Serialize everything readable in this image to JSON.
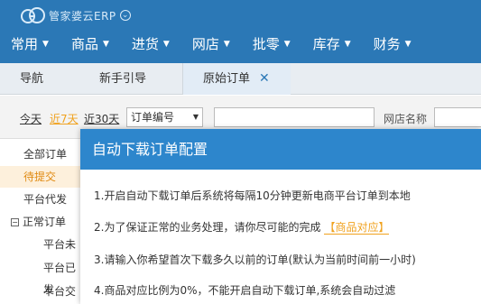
{
  "brand": {
    "name": "管家婆云ERP"
  },
  "menu": [
    {
      "label": "常用"
    },
    {
      "label": "商品"
    },
    {
      "label": "进货"
    },
    {
      "label": "网店"
    },
    {
      "label": "批零"
    },
    {
      "label": "库存"
    },
    {
      "label": "财务"
    }
  ],
  "tabs": [
    {
      "label": "导航"
    },
    {
      "label": "新手引导"
    },
    {
      "label": "原始订单"
    }
  ],
  "filters": {
    "today": "今天",
    "last7": "近7天",
    "last30": "近30天",
    "field_select": "订单编号",
    "store_label": "网店名称"
  },
  "sidebar": {
    "items": [
      {
        "label": "全部订单"
      },
      {
        "label": "待提交"
      },
      {
        "label": "平台代发"
      },
      {
        "label": "正常订单"
      },
      {
        "label": "平台未"
      },
      {
        "label": "平台已发"
      },
      {
        "label": "平台交易"
      }
    ]
  },
  "modal": {
    "title": "自动下载订单配置",
    "line1": "1.开启自动下载订单后系统将每隔10分钟更新电商平台订单到本地",
    "line2": "2.为了保证正常的业务处理，请你尽可能的完成",
    "line2_link": "【商品对应】",
    "line3": "3.请输入你希望首次下载多久以前的订单(默认为当前时间前一小时)",
    "line4": "4.商品对应比例为0%，不能开启自动下载订单,系统会自动过滤"
  },
  "colors": {
    "header": "#2b78b6",
    "modal_header": "#2d86cc",
    "accent": "#f0a21f"
  }
}
